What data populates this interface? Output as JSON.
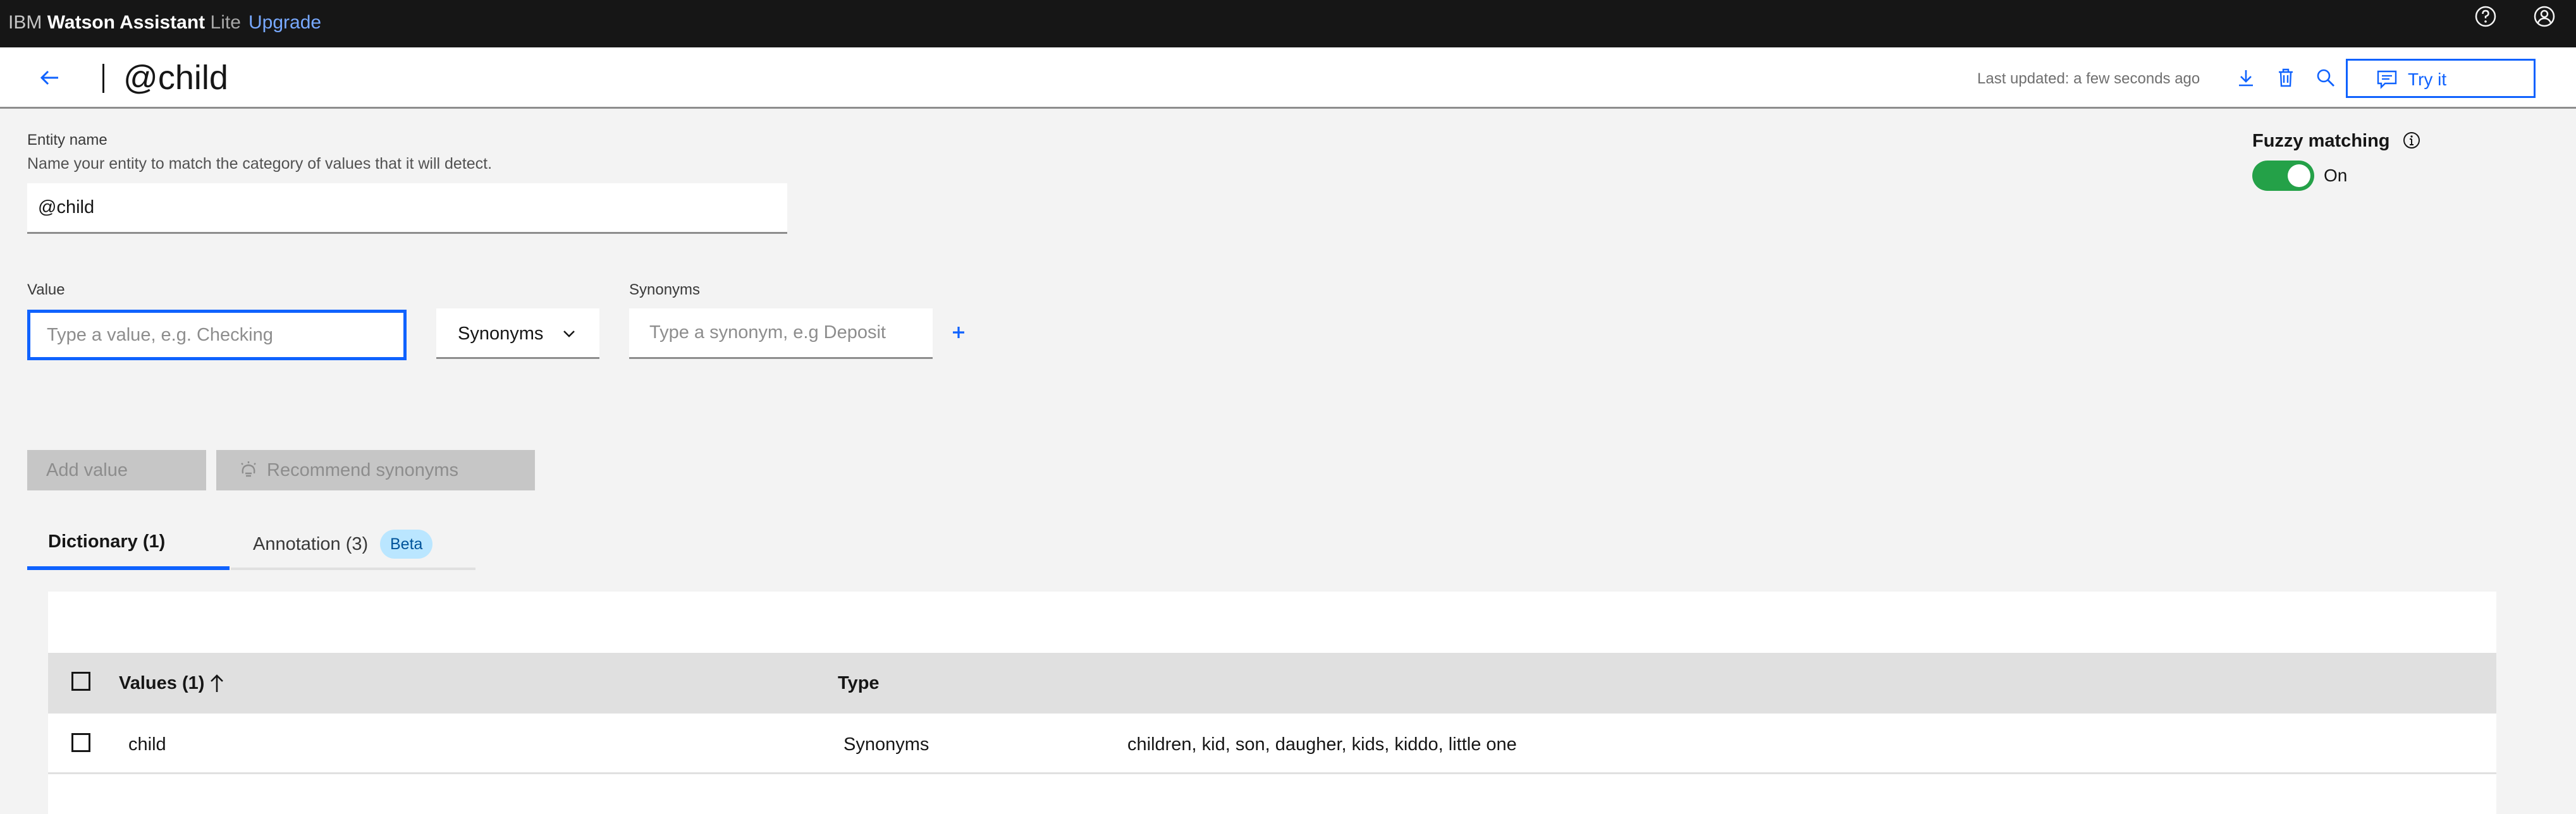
{
  "topbar": {
    "brand_prefix": "IBM",
    "brand_name": "Watson Assistant",
    "brand_plan": "Lite",
    "upgrade_label": "Upgrade",
    "icons": [
      "help-icon",
      "user-profile-icon"
    ]
  },
  "header": {
    "title": "@child",
    "last_updated": "Last updated: a few seconds ago",
    "icons": [
      "arrow-left-icon",
      "download-icon",
      "delete-icon",
      "search-icon",
      "chat-icon"
    ],
    "try_label": "Try it"
  },
  "entity": {
    "label": "Entity name",
    "helper": "Name your entity to match the category of values that it will detect.",
    "value": "@child"
  },
  "fuzzy": {
    "title": "Fuzzy matching",
    "state": "On",
    "enabled": true,
    "accent_color": "#24a148"
  },
  "value_form": {
    "value_label": "Value",
    "value_placeholder": "Type a value, e.g. Checking",
    "type_selected": "Synonyms",
    "synonyms_label": "Synonyms",
    "synonyms_placeholder": "Type a synonym, e.g Deposit",
    "add_value_label": "Add value",
    "recommend_label": "Recommend synonyms"
  },
  "tabs": [
    {
      "label": "Dictionary (1)",
      "active": true
    },
    {
      "label": "Annotation (3)",
      "badge": "Beta",
      "active": false
    }
  ],
  "table": {
    "headers": [
      "Values (1)",
      "Type"
    ],
    "rows": [
      {
        "value": "child",
        "type": "Synonyms",
        "synonyms": "children, kid, son, daugher, kids, kiddo, little one"
      }
    ]
  },
  "colors": {
    "primary": "#0f62fe",
    "topbar_bg": "#161616",
    "page_bg": "#f3f3f3",
    "beta_bg": "#bae6ff"
  }
}
